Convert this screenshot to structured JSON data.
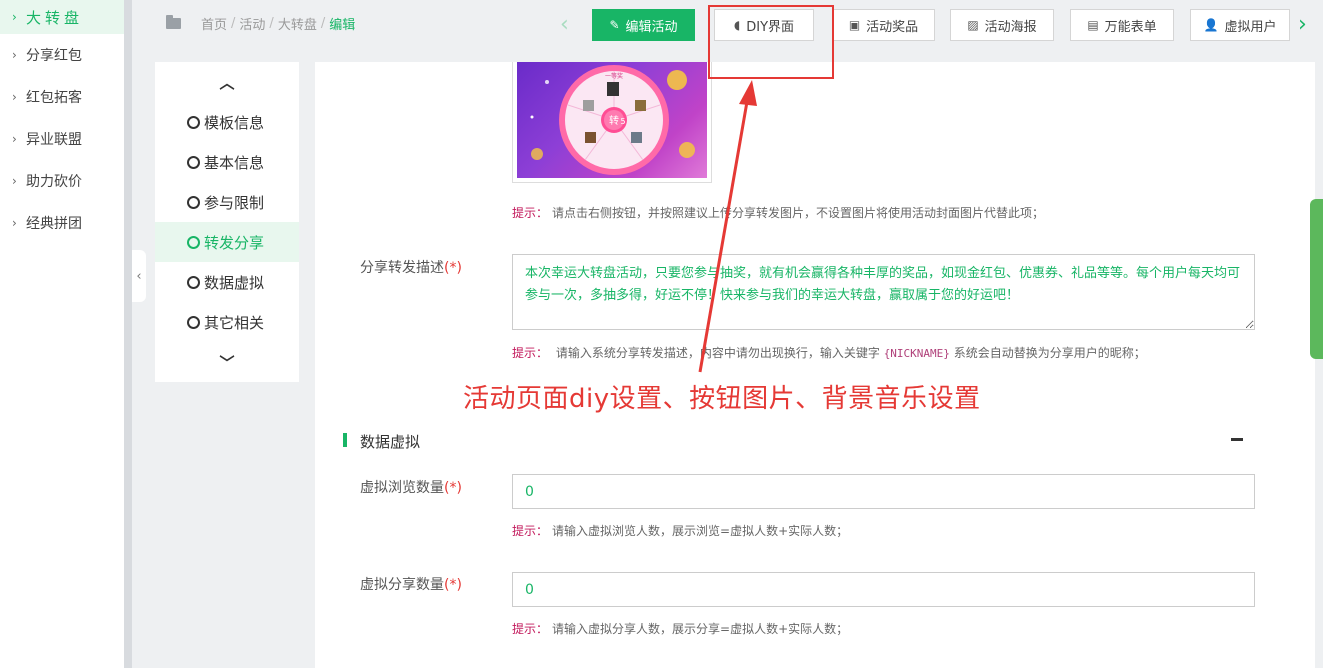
{
  "sidebar": {
    "items": [
      {
        "label": "大转盘",
        "active": true
      },
      {
        "label": "分享红包"
      },
      {
        "label": "红包拓客"
      },
      {
        "label": "异业联盟"
      },
      {
        "label": "助力砍价"
      },
      {
        "label": "经典拼团"
      }
    ]
  },
  "breadcrumb": {
    "items": [
      "首页",
      "活动",
      "大转盘"
    ],
    "current": "编辑",
    "separator": "/"
  },
  "toolbar": {
    "edit": "编辑活动",
    "diy": "DIY界面",
    "prizes": "活动奖品",
    "poster": "活动海报",
    "form": "万能表单",
    "virtual_users": "虚拟用户"
  },
  "steps": [
    {
      "label": "模板信息"
    },
    {
      "label": "基本信息"
    },
    {
      "label": "参与限制"
    },
    {
      "label": "转发分享",
      "active": true
    },
    {
      "label": "数据虚拟"
    },
    {
      "label": "其它相关"
    }
  ],
  "share": {
    "image_tip_label": "提示：",
    "image_tip": "请点击右侧按钮，并按照建议上传分享转发图片，不设置图片将使用活动封面图片代替此项；",
    "desc_label": "分享转发描述",
    "desc_value": "本次幸运大转盘活动，只要您参与抽奖，就有机会赢得各种丰厚的奖品，如现金红包、优惠券、礼品等等。每个用户每天均可参与一次，多抽多得，好运不停！快来参与我们的幸运大转盘，赢取属于您的好运吧！",
    "desc_tip_label": "提示：",
    "desc_tip_a": "请输入系统分享转发描述，内容中请勿出现换行，输入关键字",
    "desc_tip_keyword": "{NICKNAME}",
    "desc_tip_b": "系统会自动替换为分享用户的昵称；"
  },
  "annotation": "活动页面diy设置、按钮图片、背景音乐设置",
  "virtual": {
    "section_title": "数据虚拟",
    "views_label": "虚拟浏览数量",
    "views_value": "0",
    "views_tip_label": "提示：",
    "views_tip": "请输入虚拟浏览人数，展示浏览=虚拟人数+实际人数；",
    "shares_label": "虚拟分享数量",
    "shares_value": "0",
    "shares_tip_label": "提示：",
    "shares_tip": "请输入虚拟分享人数，展示分享=虚拟人数+实际人数；"
  },
  "required_mark": "(*)",
  "wheel_image": {
    "top_label": "一等奖",
    "center_label": "转",
    "bottom_label": "5",
    "segment_labels": [
      "谢谢参与",
      "四等奖",
      "三等奖",
      "二等奖",
      "五等奖"
    ]
  },
  "icons": {
    "folder": "folder-icon",
    "edit": "edit-icon",
    "leaf": "leaf-icon",
    "gift": "gift-icon",
    "image": "image-icon",
    "doc": "document-icon",
    "user_add": "user-add-icon"
  },
  "colors": {
    "brand": "#18b566",
    "annotation": "#e53935",
    "tip_label": "#c2185b"
  }
}
